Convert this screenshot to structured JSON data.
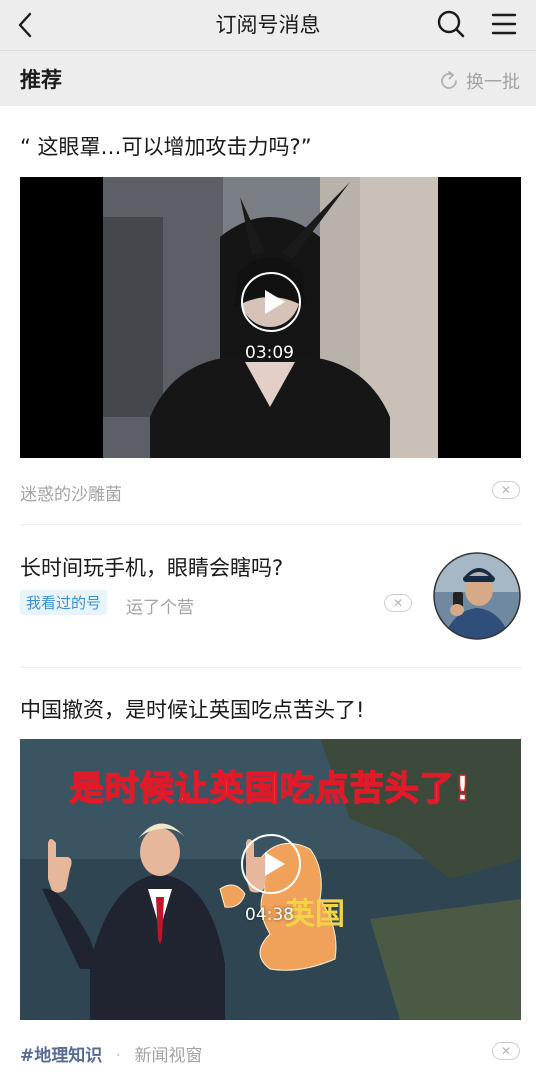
{
  "header": {
    "title": "订阅号消息",
    "back_icon": "back-chevron-icon",
    "search_icon": "search-icon",
    "menu_icon": "menu-icon"
  },
  "section": {
    "label": "推荐",
    "refresh_label": "换一批",
    "refresh_icon": "refresh-icon"
  },
  "articles": [
    {
      "title": "“ 这眼罩…可以增加攻击力吗?”",
      "duration": "03:09",
      "source": "迷惑的沙雕菌"
    },
    {
      "title": "长时间玩手机，眼睛会瞎吗?",
      "tag": "我看过的号",
      "source": "运了个营"
    },
    {
      "title": "中国撤资，是时候让英国吃点苦头了!",
      "thumbnail_caption": "是时候让英国吃点苦头了!",
      "map_label": "英国",
      "duration": "04:38",
      "topic": "#地理知识",
      "separator": "·",
      "source": "新闻视窗"
    }
  ],
  "colors": {
    "bar_bg": "#ededed",
    "muted_text": "#a3a3a3",
    "tag_text": "#3a8fd1",
    "tag_bg": "#e8f4fb"
  }
}
